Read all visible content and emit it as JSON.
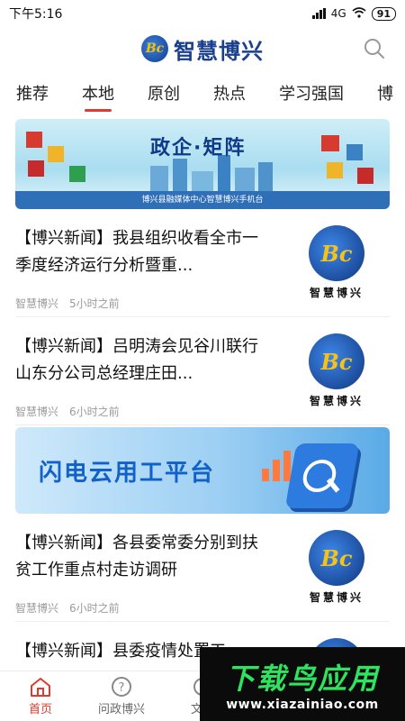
{
  "status_bar": {
    "time": "下午5:16",
    "network": "4G",
    "battery": "91"
  },
  "header": {
    "app_name": "智慧博兴",
    "logo_mark": "Bc"
  },
  "tabs": [
    {
      "label": "推荐"
    },
    {
      "label": "本地"
    },
    {
      "label": "原创"
    },
    {
      "label": "热点"
    },
    {
      "label": "学习强国"
    },
    {
      "label": "博"
    }
  ],
  "banner1": {
    "title": "政企·矩阵",
    "footer": "博兴县融媒体中心智慧博兴手机台"
  },
  "news": [
    {
      "title": "【博兴新闻】我县组织收看全市一季度经济运行分析暨重...",
      "source": "智慧博兴",
      "time": "5小时之前",
      "thumb_text": "智慧博兴"
    },
    {
      "title": "【博兴新闻】吕明涛会见谷川联行山东分公司总经理庄田...",
      "source": "智慧博兴",
      "time": "6小时之前",
      "thumb_text": "智慧博兴"
    },
    {
      "title": "【博兴新闻】各县委常委分别到扶贫工作重点村走访调研",
      "source": "智慧博兴",
      "time": "6小时之前",
      "thumb_text": "智慧博兴"
    },
    {
      "title": "【博兴新闻】县委疫情处置工",
      "source": "",
      "time": "",
      "thumb_text": ""
    }
  ],
  "banner2": {
    "title": "闪电云用工平台"
  },
  "bottom_nav": [
    {
      "label": "首页"
    },
    {
      "label": "问政博兴"
    },
    {
      "label": "文明"
    }
  ],
  "watermark": {
    "title": "下载鸟应用",
    "url": "www.xiazainiao.com"
  },
  "colors": {
    "accent": "#e0392f",
    "brand": "#1a3f8f"
  }
}
